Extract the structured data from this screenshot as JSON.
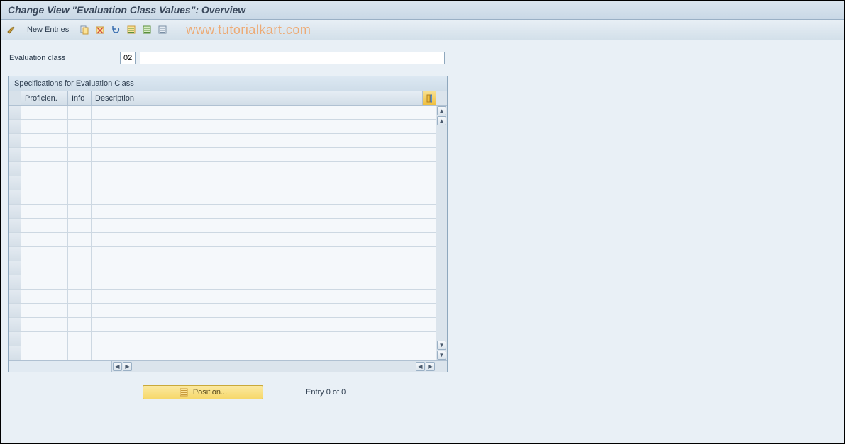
{
  "header": {
    "title": "Change View \"Evaluation Class Values\": Overview"
  },
  "toolbar": {
    "new_entries_label": "New Entries",
    "watermark": "www.tutorialkart.com"
  },
  "field": {
    "label": "Evaluation class",
    "value": "02",
    "description": ""
  },
  "panel": {
    "title": "Specifications for Evaluation Class",
    "columns": {
      "proficien": "Proficien.",
      "info": "Info",
      "description": "Description"
    },
    "row_count": 18
  },
  "footer": {
    "position_label": "Position...",
    "entry_text": "Entry 0 of 0"
  }
}
